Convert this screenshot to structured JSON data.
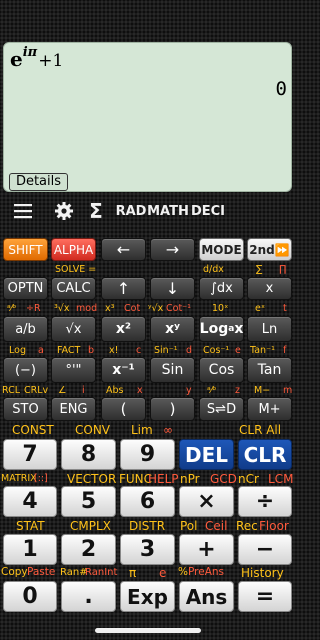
{
  "display": {
    "expr_base": "e",
    "expr_exp": "iπ",
    "expr_rest": "+1",
    "result": "0",
    "details_label": "Details"
  },
  "toolbar": {
    "menu_icon": "hamburger-menu-icon",
    "settings_icon": "gear-icon",
    "sigma_icon": "sigma-icon",
    "rad": "RAD",
    "math": "MATH",
    "deci": "DECI"
  },
  "keys": {
    "shift": "SHIFT",
    "alpha": "ALPHA",
    "left": "←",
    "right": "→",
    "mode": "MODE",
    "second": "2nd⏩",
    "optn": "OPTN",
    "calc": "CALC",
    "up": "↑",
    "down": "↓",
    "integral": "∫dx",
    "x": "x",
    "ab": "a/b",
    "sqrt": "√x",
    "sq": "x²",
    "pow": "xʸ",
    "log_pre": "Log",
    "log_sub": "a",
    "log_post": "x",
    "ln": "Ln",
    "neg": "(−)",
    "deg": "°'\"",
    "inv": "x⁻¹",
    "sin": "Sin",
    "cos": "Cos",
    "tan": "Tan",
    "sto": "STO",
    "eng": "ENG",
    "lp": "(",
    "rp": ")",
    "sd": "S⇌D",
    "mplus": "M+",
    "n7": "7",
    "n8": "8",
    "n9": "9",
    "del": "DEL",
    "clr": "CLR",
    "n4": "4",
    "n5": "5",
    "n6": "6",
    "mul": "×",
    "div": "÷",
    "n1": "1",
    "n2": "2",
    "n3": "3",
    "add": "+",
    "sub": "−",
    "n0": "0",
    "dot": ".",
    "exp": "Exp",
    "ans": "Ans",
    "eq": "="
  },
  "labels": {
    "r1": [
      "SOLVE =",
      "d/dx",
      "∑",
      "∏"
    ],
    "r2": [
      "ᵃ⁄ᵇ",
      "÷R",
      "³√x",
      "mod",
      "x³",
      "Cot",
      "ʸ√x",
      "Cot⁻¹",
      "10ˣ",
      "eˣ",
      "t"
    ],
    "r3": [
      "Log",
      "a",
      "FACT",
      "b",
      "x!",
      "c",
      "Sin⁻¹",
      "d",
      "Cos⁻¹",
      "e",
      "Tan⁻¹",
      "f"
    ],
    "r4": [
      "RCL",
      "CRLv",
      "∠",
      "i",
      "Abs",
      "x",
      "y",
      "ᵃ⁄ᵇ",
      "z",
      "M−",
      "m"
    ],
    "r5": [
      "CONST",
      "CONV",
      "Lim",
      "∞",
      "CLR All"
    ],
    "r6": [
      "MATRIX",
      "[::]",
      "VECTOR",
      "FUNC",
      "HELP",
      "nPr",
      "GCD",
      "nCr",
      "LCM"
    ],
    "r7": [
      "STAT",
      "CMPLX",
      "DISTR",
      "Pol",
      "Ceil",
      "Rec",
      "Floor"
    ],
    "r8": [
      "Copy",
      "Paste",
      "Ran#",
      "RanInt",
      "π",
      "e",
      "%",
      "PreAns",
      "History"
    ]
  }
}
